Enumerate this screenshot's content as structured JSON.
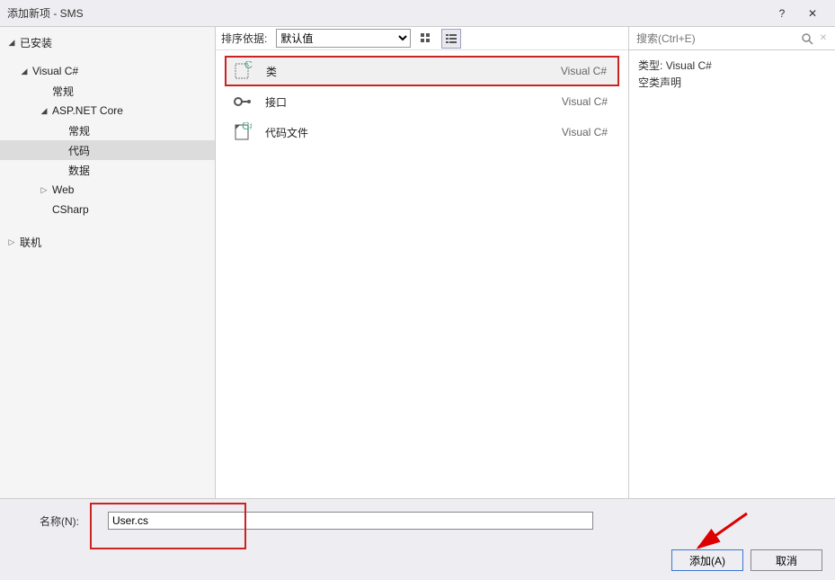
{
  "title": "添加新项 - SMS",
  "sidebar": {
    "installed": "已安装",
    "online": "联机",
    "nodes": {
      "visual_csharp": "Visual C#",
      "general1": "常规",
      "aspnetcore": "ASP.NET Core",
      "general2": "常规",
      "code": "代码",
      "data": "数据",
      "web": "Web",
      "csharp": "CSharp"
    }
  },
  "toolbar": {
    "sort_label": "排序依据:",
    "sort_value": "默认值"
  },
  "search": {
    "placeholder": "搜索(Ctrl+E)"
  },
  "templates": [
    {
      "name": "类",
      "tag": "Visual C#"
    },
    {
      "name": "接口",
      "tag": "Visual C#"
    },
    {
      "name": "代码文件",
      "tag": "Visual C#"
    }
  ],
  "details": {
    "type_label": "类型:",
    "type_value": "Visual C#",
    "desc": "空类声明"
  },
  "name_field": {
    "label": "名称(N):",
    "value": "User.cs"
  },
  "buttons": {
    "add": "添加(A)",
    "cancel": "取消"
  }
}
